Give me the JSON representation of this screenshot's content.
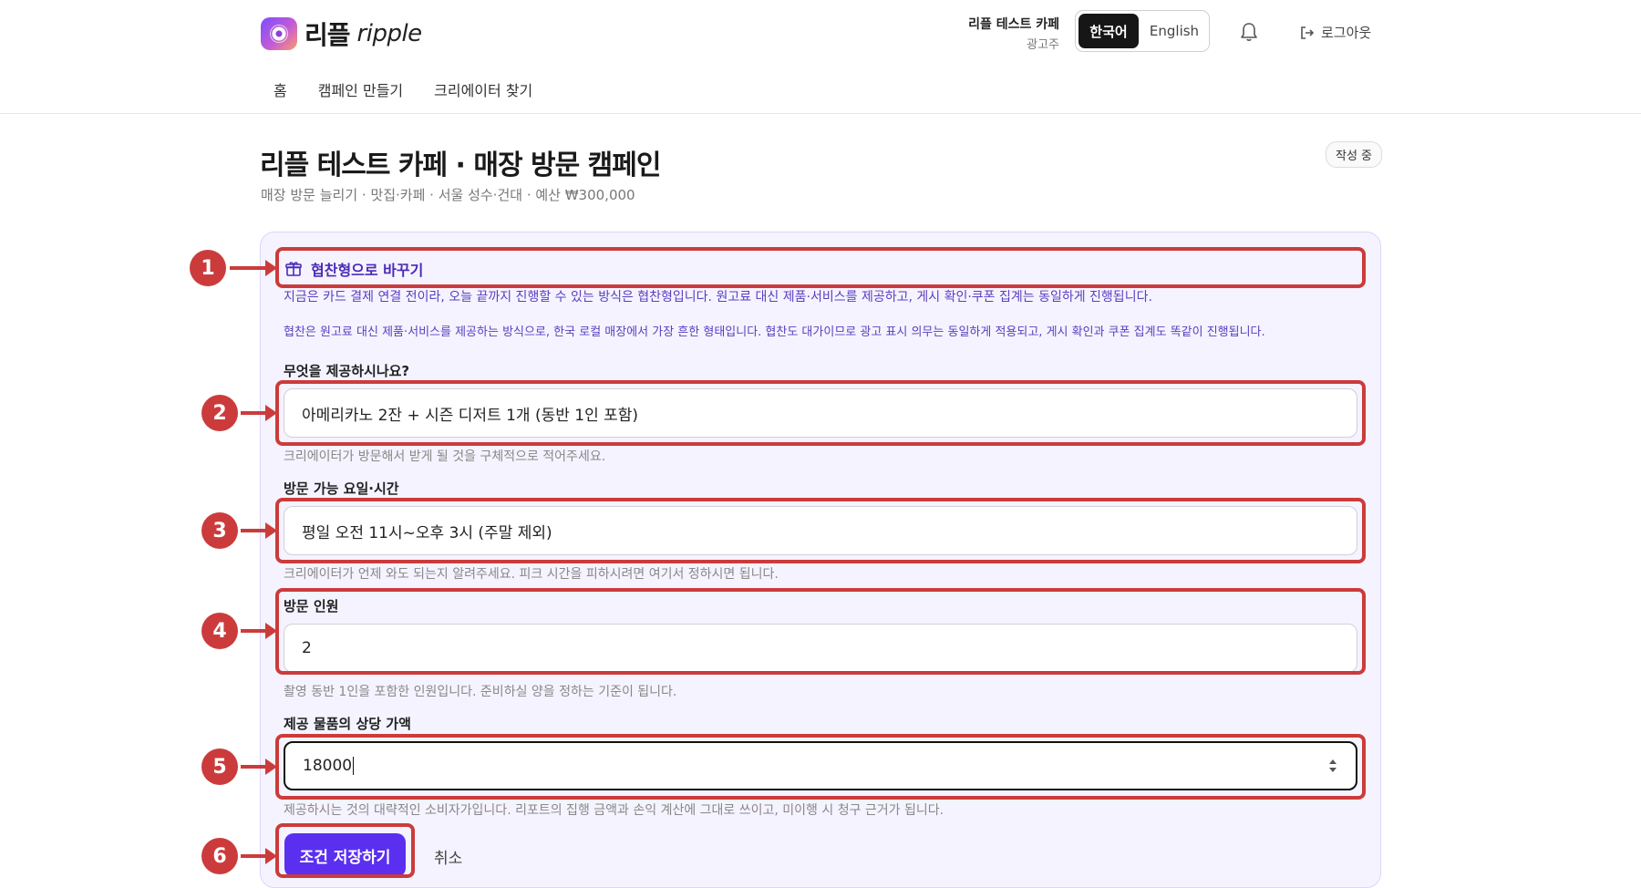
{
  "brand": {
    "name_ko": "리플",
    "name_en": "ripple"
  },
  "account": {
    "name": "리플 테스트 카페",
    "role": "광고주"
  },
  "language": {
    "korean": "한국어",
    "english": "English",
    "selected": "한국어"
  },
  "header": {
    "logout_label": "로그아웃"
  },
  "nav": {
    "home": "홈",
    "create_campaign": "캠페인 만들기",
    "find_creators": "크리에이터 찾기"
  },
  "page": {
    "title": "리플 테스트 카페 · 매장 방문 캠페인",
    "subtitle": "매장 방문 늘리기 · 맛집·카페 · 서울 성수·건대 · 예산 ₩300,000",
    "status": "작성 중"
  },
  "sponsorship": {
    "switch_label": "협찬형으로 바꾸기",
    "notice": "지금은 카드 결제 연결 전이라, 오늘 끝까지 진행할 수 있는 방식은 협찬형입니다. 원고료 대신 제품·서비스를 제공하고, 게시 확인·쿠폰 집계는 동일하게 진행됩니다.",
    "explanation": "협찬은 원고료 대신 제품·서비스를 제공하는 방식으로, 한국 로컬 매장에서 가장 흔한 형태입니다. 협찬도 대가이므로 광고 표시 의무는 동일하게 적용되고, 게시 확인과 쿠폰 집계도 똑같이 진행됩니다."
  },
  "form": {
    "offer": {
      "label": "무엇을 제공하시나요?",
      "value": "아메리카노 2잔 + 시즌 디저트 1개 (동반 1인 포함)",
      "help": "크리에이터가 방문해서 받게 될 것을 구체적으로 적어주세요."
    },
    "schedule": {
      "label": "방문 가능 요일·시간",
      "value": "평일 오전 11시~오후 3시 (주말 제외)",
      "help": "크리에이터가 언제 와도 되는지 알려주세요. 피크 시간을 피하시려면 여기서 정하시면 됩니다."
    },
    "headcount": {
      "label": "방문 인원",
      "value": "2",
      "help": "촬영 동반 1인을 포함한 인원입니다. 준비하실 양을 정하는 기준이 됩니다."
    },
    "value_amount": {
      "label": "제공 물품의 상당 가액",
      "value": "18000",
      "help": "제공하시는 것의 대략적인 소비자가입니다. 리포트의 집행 금액과 손익 계산에 그대로 쓰이고, 미이행 시 청구 근거가 됩니다."
    },
    "save_label": "조건 저장하기",
    "cancel_label": "취소"
  },
  "callouts": [
    "1",
    "2",
    "3",
    "4",
    "5",
    "6"
  ],
  "colors": {
    "accent": "#5b2ff0",
    "callout": "#cc3b3b",
    "panel": "#f5f3ff",
    "notice_text": "#5a3fc0"
  }
}
